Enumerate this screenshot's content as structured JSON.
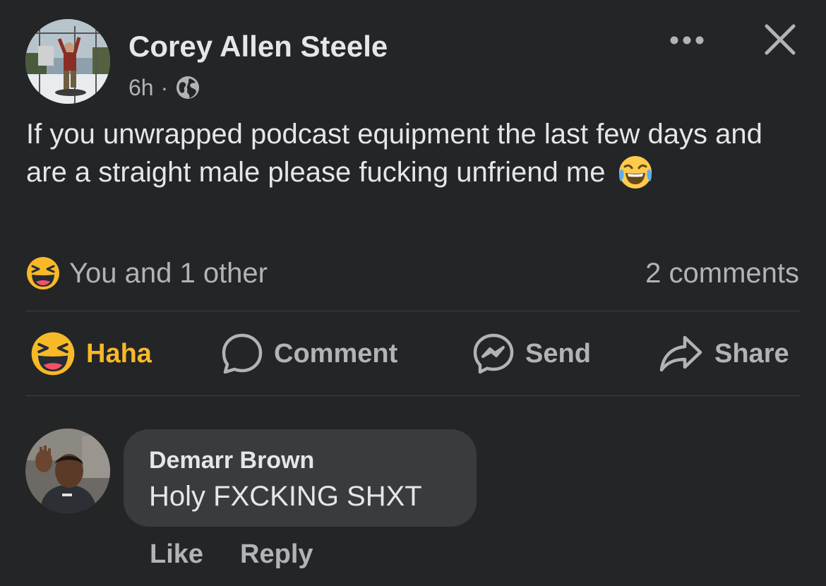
{
  "post": {
    "author": "Corey Allen Steele",
    "time": "6h",
    "separator": "·",
    "privacy_icon": "globe-icon",
    "text": "If you unwrapped podcast equipment the last few days and are a straight male please fucking unfriend me",
    "text_emoji": "face-with-tears-of-joy-emoji"
  },
  "header_actions": {
    "more_icon": "more-horizontal-icon",
    "close_icon": "close-icon"
  },
  "reactions": {
    "icon": "haha-reaction-icon",
    "summary": "You and 1 other",
    "comments_count": "2 comments"
  },
  "actions": {
    "haha": "Haha",
    "comment": "Comment",
    "send": "Send",
    "share": "Share"
  },
  "comment": {
    "author": "Demarr Brown",
    "text": "Holy FXCKING SHXT",
    "like": "Like",
    "reply": "Reply"
  },
  "colors": {
    "background": "#242526",
    "bubble": "#3a3b3c",
    "primary_text": "#e4e6eb",
    "secondary_text": "#b0b3b8",
    "active_reaction": "#f7b928",
    "divider": "#3e4042"
  }
}
